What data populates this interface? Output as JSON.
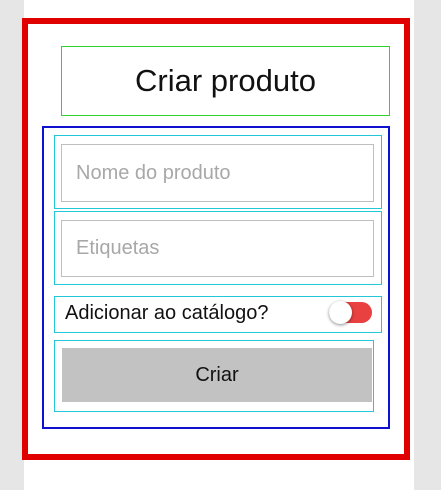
{
  "screen": {
    "title": "Criar produto"
  },
  "form": {
    "name_field": {
      "value": "",
      "placeholder": "Nome do produto"
    },
    "tags_field": {
      "value": "",
      "placeholder": "Etiquetas"
    },
    "catalog_toggle": {
      "label": "Adicionar ao catálogo?",
      "checked": false,
      "track_color": "#e94040"
    },
    "submit_label": "Criar"
  },
  "colors": {
    "outer_frame": "#e00000",
    "title_frame": "#2bd32b",
    "form_frame": "#1010d0",
    "item_frame": "#22c8d8",
    "button_bg": "#c2c2c2"
  }
}
